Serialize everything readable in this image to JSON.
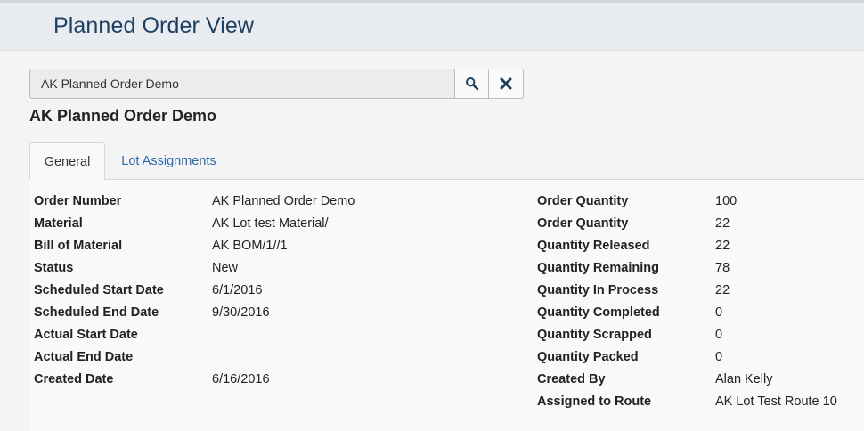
{
  "header": {
    "title": "Planned Order View"
  },
  "search": {
    "value": "AK Planned Order Demo",
    "placeholder": ""
  },
  "record": {
    "title": "AK Planned Order Demo"
  },
  "tabs": [
    {
      "label": "General",
      "active": true
    },
    {
      "label": "Lot Assignments",
      "active": false
    }
  ],
  "general": {
    "left": [
      {
        "label": "Order Number",
        "value": "AK Planned Order Demo"
      },
      {
        "label": "Material",
        "value": "AK Lot test Material/"
      },
      {
        "label": "Bill of Material",
        "value": "AK BOM/1//1"
      },
      {
        "label": "Status",
        "value": "New"
      },
      {
        "label": "Scheduled Start Date",
        "value": "6/1/2016"
      },
      {
        "label": "Scheduled End Date",
        "value": "9/30/2016"
      },
      {
        "label": "Actual Start Date",
        "value": ""
      },
      {
        "label": "Actual End Date",
        "value": ""
      },
      {
        "label": "Created Date",
        "value": "6/16/2016"
      }
    ],
    "right": [
      {
        "label": "Order Quantity",
        "value": "100"
      },
      {
        "label": "Order Quantity",
        "value": "22"
      },
      {
        "label": "Quantity Released",
        "value": "22"
      },
      {
        "label": "Quantity Remaining",
        "value": "78"
      },
      {
        "label": "Quantity In Process",
        "value": "22"
      },
      {
        "label": "Quantity Completed",
        "value": "0"
      },
      {
        "label": "Quantity Scrapped",
        "value": "0"
      },
      {
        "label": "Quantity Packed",
        "value": "0"
      },
      {
        "label": "Created By",
        "value": "Alan Kelly"
      },
      {
        "label": "Assigned to Route",
        "value": "AK Lot Test Route 10"
      }
    ]
  },
  "icons": {
    "search": "search-icon",
    "clear": "close-icon"
  },
  "colors": {
    "header_title": "#1f3f62",
    "link": "#2d6aa8",
    "icon": "#1f3f62"
  }
}
